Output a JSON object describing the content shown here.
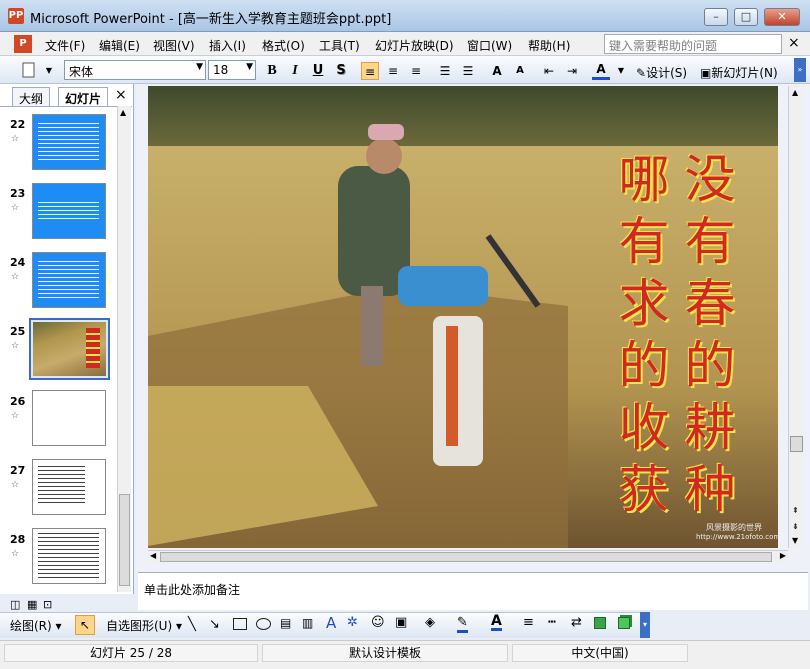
{
  "window": {
    "title": "Microsoft PowerPoint - [高一新生入学教育主题班会ppt.ppt]",
    "app_icon": "PP",
    "minimize": "–",
    "maximize": "□",
    "close": "✕"
  },
  "menu": {
    "doc_icon": "P",
    "items": [
      "文件(F)",
      "编辑(E)",
      "视图(V)",
      "插入(I)",
      "格式(O)",
      "工具(T)",
      "幻灯片放映(D)",
      "窗口(W)",
      "帮助(H)"
    ],
    "help_placeholder": "键入需要帮助的问题",
    "close_doc": "×"
  },
  "toolbar": {
    "font": "宋体",
    "size": "18",
    "bold": "B",
    "italic": "I",
    "underline": "U",
    "shadow": "S",
    "grow": "A",
    "shrink": "A",
    "font_color": "A",
    "design": "设计(S)",
    "new_slide": "新幻灯片(N)"
  },
  "panel": {
    "tabs": [
      "大纲",
      "幻灯片"
    ],
    "close": "×",
    "slides": [
      {
        "num": "22",
        "style": "blue"
      },
      {
        "num": "23",
        "style": "blue"
      },
      {
        "num": "24",
        "style": "blue"
      },
      {
        "num": "25",
        "style": "photo"
      },
      {
        "num": "26",
        "style": "white"
      },
      {
        "num": "27",
        "style": "text"
      },
      {
        "num": "28",
        "style": "text"
      }
    ]
  },
  "slide": {
    "col1": "没有春的耕种",
    "col2": "哪有求的收获",
    "watermark": "风景摄影的世界",
    "watermark_url": "http://www.21ofoto.com"
  },
  "notes": {
    "placeholder": "单击此处添加备注"
  },
  "drawbar": {
    "draw": "绘图(R)",
    "autoshapes": "自选图形(U)"
  },
  "status": {
    "slide": "幻灯片 25 / 28",
    "template": "默认设计模板",
    "lang": "中文(中国)"
  },
  "colors": {
    "accent_blue": "#1e8cf5",
    "slide_text": "#d1281f",
    "text_outline": "#f5e54c",
    "font_color_bar": "#1f4cc8"
  }
}
